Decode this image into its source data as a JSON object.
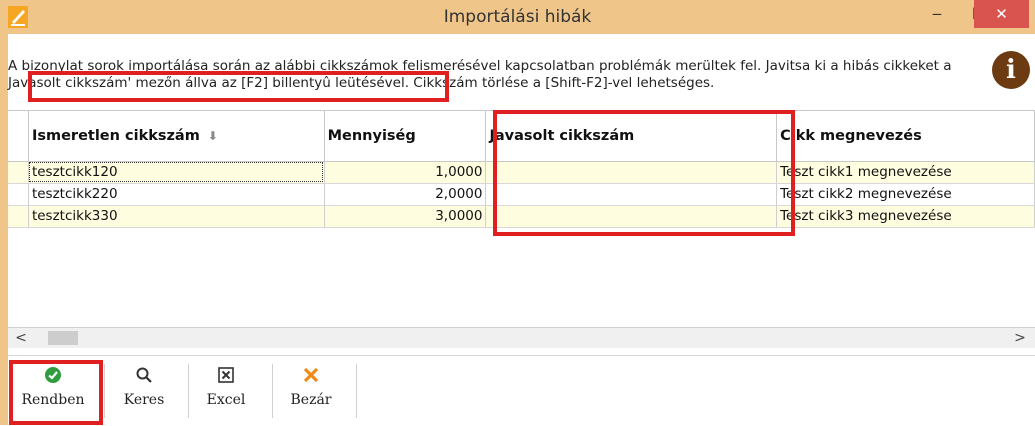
{
  "window": {
    "title": "Importálási hibák",
    "minimize": "‒",
    "maximize": "☐",
    "close": "✕"
  },
  "message": {
    "line1": "A bizonylat sorok importálása során az alábbi cikkszámok felismerésével kapcsolatban problémák merültek fel. Javitsa ki a hibás cikkeket a",
    "line2": "Javasolt cikkszám' mezőn állva az [F2] billentyû leütésével. Cikkszám törlése a [Shift-F2]-vel lehetséges."
  },
  "info_icon": "i",
  "grid": {
    "columns": [
      "Ismeretlen cikkszám",
      "Mennyiség",
      "Javasolt cikkszám",
      "Cikk megnevezés"
    ],
    "rows": [
      [
        "tesztcikk120",
        "1,0000",
        "",
        "Teszt cikk1 megnevezése"
      ],
      [
        "tesztcikk220",
        "2,0000",
        "",
        "Teszt cikk2 megnevezése"
      ],
      [
        "tesztcikk330",
        "3,0000",
        "",
        "Teszt cikk3 megnevezése"
      ]
    ]
  },
  "scrollbar": {
    "left": "<",
    "right": ">"
  },
  "toolbar": {
    "ok_label": "Rendben",
    "search_label": "Keres",
    "excel_label": "Excel",
    "close_label": "Bezár"
  },
  "colors": {
    "title_bar": "#f0c58a",
    "close_button": "#d9534f",
    "highlight_border": "#e02020",
    "row_yellow": "#fffde0",
    "info_icon_bg": "#6d3b12",
    "ok_icon": "#2e9d3e",
    "close_icon": "#ef8a17"
  }
}
